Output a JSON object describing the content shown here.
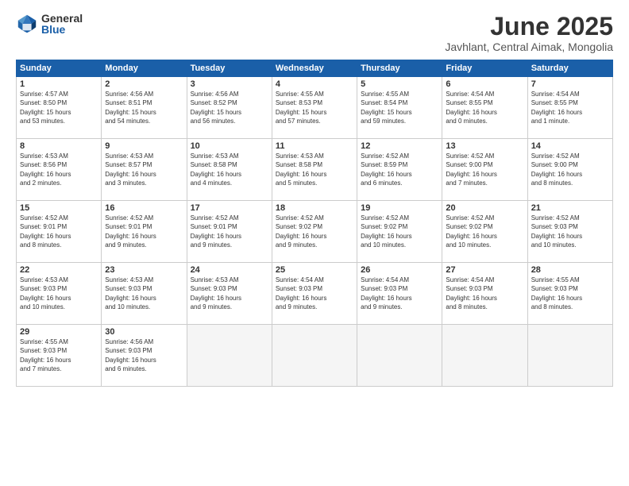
{
  "logo": {
    "general": "General",
    "blue": "Blue"
  },
  "title": "June 2025",
  "location": "Javhlant, Central Aimak, Mongolia",
  "headers": [
    "Sunday",
    "Monday",
    "Tuesday",
    "Wednesday",
    "Thursday",
    "Friday",
    "Saturday"
  ],
  "weeks": [
    [
      {
        "day": "1",
        "info": "Sunrise: 4:57 AM\nSunset: 8:50 PM\nDaylight: 15 hours\nand 53 minutes."
      },
      {
        "day": "2",
        "info": "Sunrise: 4:56 AM\nSunset: 8:51 PM\nDaylight: 15 hours\nand 54 minutes."
      },
      {
        "day": "3",
        "info": "Sunrise: 4:56 AM\nSunset: 8:52 PM\nDaylight: 15 hours\nand 56 minutes."
      },
      {
        "day": "4",
        "info": "Sunrise: 4:55 AM\nSunset: 8:53 PM\nDaylight: 15 hours\nand 57 minutes."
      },
      {
        "day": "5",
        "info": "Sunrise: 4:55 AM\nSunset: 8:54 PM\nDaylight: 15 hours\nand 59 minutes."
      },
      {
        "day": "6",
        "info": "Sunrise: 4:54 AM\nSunset: 8:55 PM\nDaylight: 16 hours\nand 0 minutes."
      },
      {
        "day": "7",
        "info": "Sunrise: 4:54 AM\nSunset: 8:55 PM\nDaylight: 16 hours\nand 1 minute."
      }
    ],
    [
      {
        "day": "8",
        "info": "Sunrise: 4:53 AM\nSunset: 8:56 PM\nDaylight: 16 hours\nand 2 minutes."
      },
      {
        "day": "9",
        "info": "Sunrise: 4:53 AM\nSunset: 8:57 PM\nDaylight: 16 hours\nand 3 minutes."
      },
      {
        "day": "10",
        "info": "Sunrise: 4:53 AM\nSunset: 8:58 PM\nDaylight: 16 hours\nand 4 minutes."
      },
      {
        "day": "11",
        "info": "Sunrise: 4:53 AM\nSunset: 8:58 PM\nDaylight: 16 hours\nand 5 minutes."
      },
      {
        "day": "12",
        "info": "Sunrise: 4:52 AM\nSunset: 8:59 PM\nDaylight: 16 hours\nand 6 minutes."
      },
      {
        "day": "13",
        "info": "Sunrise: 4:52 AM\nSunset: 9:00 PM\nDaylight: 16 hours\nand 7 minutes."
      },
      {
        "day": "14",
        "info": "Sunrise: 4:52 AM\nSunset: 9:00 PM\nDaylight: 16 hours\nand 8 minutes."
      }
    ],
    [
      {
        "day": "15",
        "info": "Sunrise: 4:52 AM\nSunset: 9:01 PM\nDaylight: 16 hours\nand 8 minutes."
      },
      {
        "day": "16",
        "info": "Sunrise: 4:52 AM\nSunset: 9:01 PM\nDaylight: 16 hours\nand 9 minutes."
      },
      {
        "day": "17",
        "info": "Sunrise: 4:52 AM\nSunset: 9:01 PM\nDaylight: 16 hours\nand 9 minutes."
      },
      {
        "day": "18",
        "info": "Sunrise: 4:52 AM\nSunset: 9:02 PM\nDaylight: 16 hours\nand 9 minutes."
      },
      {
        "day": "19",
        "info": "Sunrise: 4:52 AM\nSunset: 9:02 PM\nDaylight: 16 hours\nand 10 minutes."
      },
      {
        "day": "20",
        "info": "Sunrise: 4:52 AM\nSunset: 9:02 PM\nDaylight: 16 hours\nand 10 minutes."
      },
      {
        "day": "21",
        "info": "Sunrise: 4:52 AM\nSunset: 9:03 PM\nDaylight: 16 hours\nand 10 minutes."
      }
    ],
    [
      {
        "day": "22",
        "info": "Sunrise: 4:53 AM\nSunset: 9:03 PM\nDaylight: 16 hours\nand 10 minutes."
      },
      {
        "day": "23",
        "info": "Sunrise: 4:53 AM\nSunset: 9:03 PM\nDaylight: 16 hours\nand 10 minutes."
      },
      {
        "day": "24",
        "info": "Sunrise: 4:53 AM\nSunset: 9:03 PM\nDaylight: 16 hours\nand 9 minutes."
      },
      {
        "day": "25",
        "info": "Sunrise: 4:54 AM\nSunset: 9:03 PM\nDaylight: 16 hours\nand 9 minutes."
      },
      {
        "day": "26",
        "info": "Sunrise: 4:54 AM\nSunset: 9:03 PM\nDaylight: 16 hours\nand 9 minutes."
      },
      {
        "day": "27",
        "info": "Sunrise: 4:54 AM\nSunset: 9:03 PM\nDaylight: 16 hours\nand 8 minutes."
      },
      {
        "day": "28",
        "info": "Sunrise: 4:55 AM\nSunset: 9:03 PM\nDaylight: 16 hours\nand 8 minutes."
      }
    ],
    [
      {
        "day": "29",
        "info": "Sunrise: 4:55 AM\nSunset: 9:03 PM\nDaylight: 16 hours\nand 7 minutes."
      },
      {
        "day": "30",
        "info": "Sunrise: 4:56 AM\nSunset: 9:03 PM\nDaylight: 16 hours\nand 6 minutes."
      },
      {
        "day": "",
        "info": ""
      },
      {
        "day": "",
        "info": ""
      },
      {
        "day": "",
        "info": ""
      },
      {
        "day": "",
        "info": ""
      },
      {
        "day": "",
        "info": ""
      }
    ]
  ]
}
